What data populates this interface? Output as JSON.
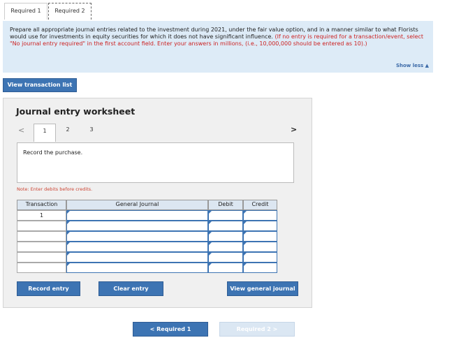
{
  "tabs": [
    {
      "label": "Required 1"
    },
    {
      "label": "Required 2"
    }
  ],
  "instructions": {
    "main": "Prepare all appropriate journal entries related to the investment during 2021, under the fair value option, and in a manner similar to what Florists would use for investments in equity securities for which it does not have significant influence.",
    "red": "(If no entry is required for a transaction/event, select \"No journal entry required\" in the first account field. Enter your answers in millions, (i.e., 10,000,000 should be entered as 10).)",
    "show_less": "Show less ▲"
  },
  "view_transaction_list": "View transaction list",
  "worksheet": {
    "title": "Journal entry worksheet",
    "pages": [
      "1",
      "2",
      "3"
    ],
    "current_page": "1",
    "prev_arrow": "<",
    "next_arrow": ">",
    "description": "Record the purchase.",
    "note": "Note: Enter debits before credits.",
    "columns": [
      "Transaction",
      "General Journal",
      "Debit",
      "Credit"
    ],
    "rows": [
      {
        "transaction": "1",
        "account": "",
        "debit": "",
        "credit": ""
      },
      {
        "transaction": "",
        "account": "",
        "debit": "",
        "credit": ""
      },
      {
        "transaction": "",
        "account": "",
        "debit": "",
        "credit": ""
      },
      {
        "transaction": "",
        "account": "",
        "debit": "",
        "credit": ""
      },
      {
        "transaction": "",
        "account": "",
        "debit": "",
        "credit": ""
      },
      {
        "transaction": "",
        "account": "",
        "debit": "",
        "credit": ""
      }
    ],
    "record_entry": "Record entry",
    "clear_entry": "Clear entry",
    "view_general_journal": "View general journal"
  },
  "nav": {
    "prev_label": "<  Required 1",
    "next_label": "Required 2  >"
  }
}
